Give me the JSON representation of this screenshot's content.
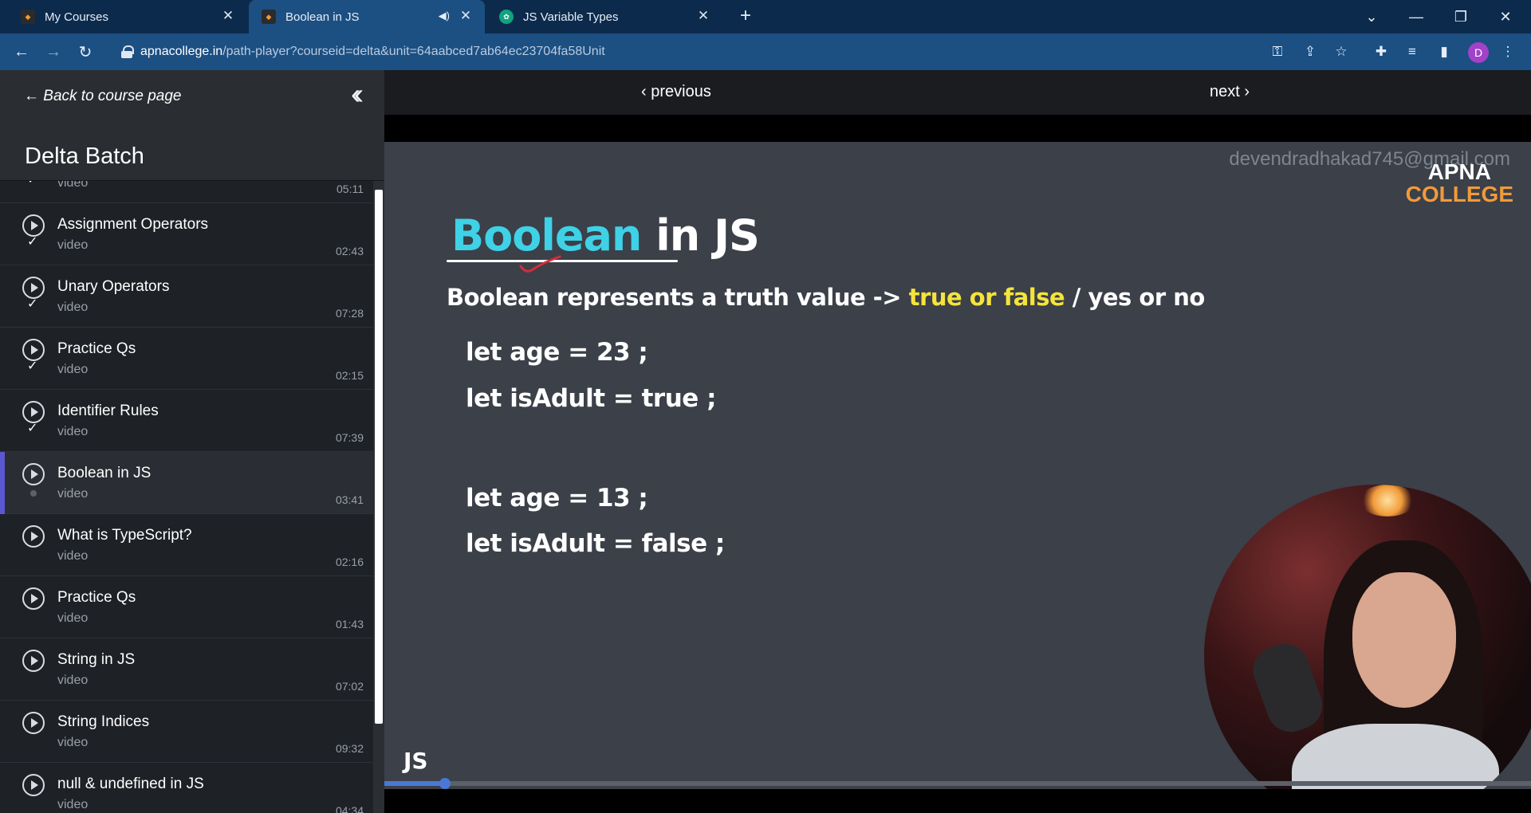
{
  "browser": {
    "tabs": [
      {
        "title": "My Courses",
        "active": false
      },
      {
        "title": "Boolean in JS",
        "active": true
      },
      {
        "title": "JS Variable Types",
        "active": false
      }
    ],
    "url_host": "apnacollege.in",
    "url_path": "/path-player?courseid=delta&unit=64aabced7ab64ec23704fa58Unit",
    "profile_initial": "D"
  },
  "sidebar": {
    "back_label": "Back to course page",
    "course_title": "Delta Batch",
    "lessons": [
      {
        "title": "",
        "type": "video",
        "time": "05:11",
        "status": "done"
      },
      {
        "title": "Assignment Operators",
        "type": "video",
        "time": "02:43",
        "status": "done"
      },
      {
        "title": "Unary Operators",
        "type": "video",
        "time": "07:28",
        "status": "done"
      },
      {
        "title": "Practice Qs",
        "type": "video",
        "time": "02:15",
        "status": "done"
      },
      {
        "title": "Identifier Rules",
        "type": "video",
        "time": "07:39",
        "status": "done"
      },
      {
        "title": "Boolean in JS",
        "type": "video",
        "time": "03:41",
        "status": "current"
      },
      {
        "title": "What is TypeScript?",
        "type": "video",
        "time": "02:16",
        "status": "todo"
      },
      {
        "title": "Practice Qs",
        "type": "video",
        "time": "01:43",
        "status": "todo"
      },
      {
        "title": "String in JS",
        "type": "video",
        "time": "07:02",
        "status": "todo"
      },
      {
        "title": "String Indices",
        "type": "video",
        "time": "09:32",
        "status": "todo"
      },
      {
        "title": "null & undefined in JS",
        "type": "video",
        "time": "04:34",
        "status": "todo"
      }
    ]
  },
  "player": {
    "previous_label": "previous",
    "next_label": "next",
    "watermark": "devendradhakad745@gmail.com",
    "brand_line1": "APNA",
    "brand_line2": "COLLEGE",
    "progress": 0.053
  },
  "slide": {
    "title_highlight": "Boolean",
    "title_rest": "in JS",
    "subtitle_start": "Boolean represents a truth value ->",
    "subtitle_highlight": "true or false",
    "subtitle_end": "/ yes or no",
    "code": [
      "let age = 23 ;",
      "let isAdult = true ;",
      "let age = 13 ;",
      "let isAdult = false ;"
    ],
    "footer": "JS"
  },
  "colors": {
    "accent": "#5b57d1",
    "title_cyan": "#3fd1e6",
    "highlight_yellow": "#f5e43a",
    "brand_orange": "#f19a3a"
  }
}
